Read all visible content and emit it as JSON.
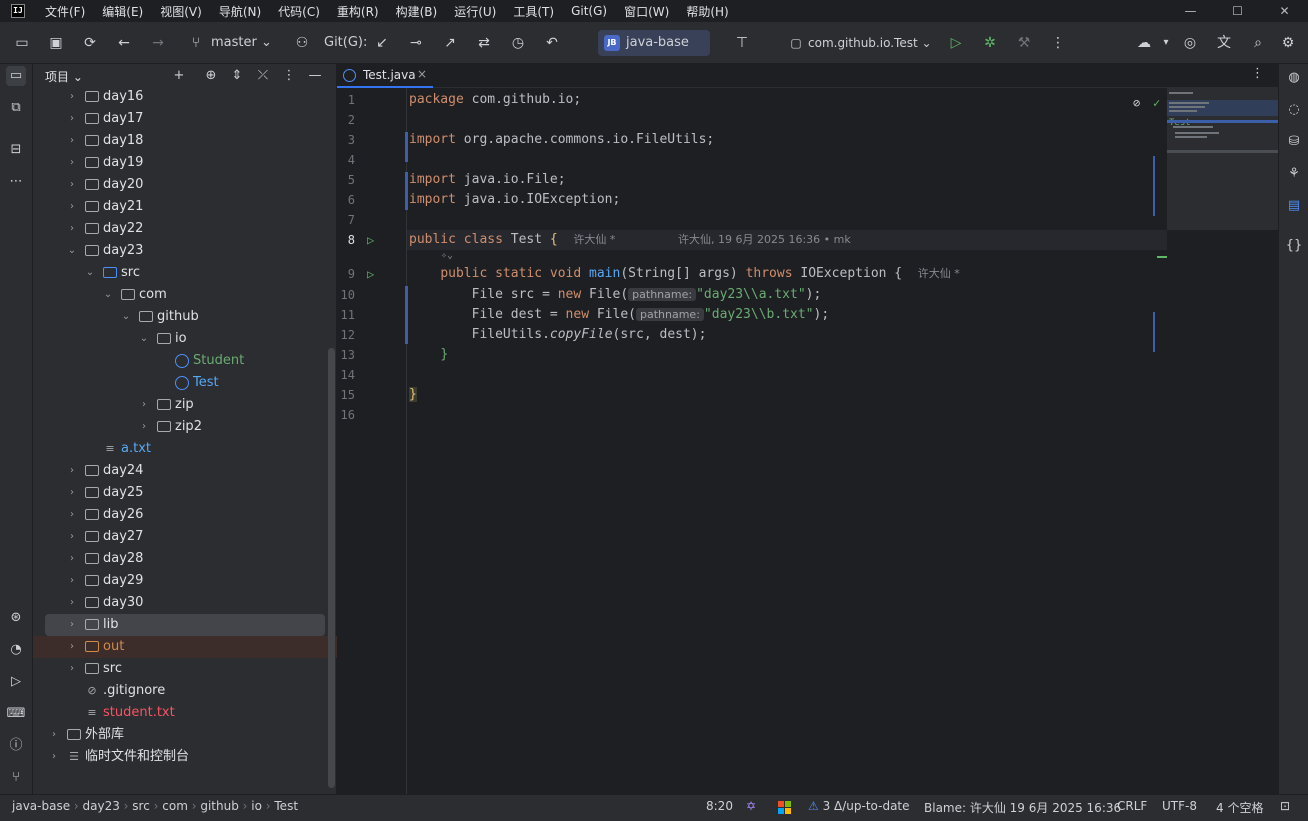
{
  "menu": [
    "文件(F)",
    "编辑(E)",
    "视图(V)",
    "导航(N)",
    "代码(C)",
    "重构(R)",
    "构建(B)",
    "运行(U)",
    "工具(T)",
    "Git(G)",
    "窗口(W)",
    "帮助(H)"
  ],
  "toolbar": {
    "branch": "master",
    "git_label": "Git(G):",
    "project_badge": "JB",
    "project_name": "java-base",
    "run_config": "com.github.io.Test"
  },
  "panel": {
    "title": "项目"
  },
  "tree": [
    {
      "label": "day16",
      "arrow": "›"
    },
    {
      "label": "day17",
      "arrow": "›"
    },
    {
      "label": "day18",
      "arrow": "›"
    },
    {
      "label": "day19",
      "arrow": "›"
    },
    {
      "label": "day20",
      "arrow": "›"
    },
    {
      "label": "day21",
      "arrow": "›"
    },
    {
      "label": "day22",
      "arrow": "›"
    },
    {
      "label": "day23",
      "arrow": "⌄"
    },
    {
      "label": "src",
      "arrow": "⌄"
    },
    {
      "label": "com",
      "arrow": "⌄"
    },
    {
      "label": "github",
      "arrow": "⌄"
    },
    {
      "label": "io",
      "arrow": "⌄"
    },
    {
      "label": "Student",
      "icon": "C"
    },
    {
      "label": "Test",
      "icon": "C"
    },
    {
      "label": "zip",
      "arrow": "›"
    },
    {
      "label": "zip2",
      "arrow": "›"
    },
    {
      "label": "a.txt"
    },
    {
      "label": "day24",
      "arrow": "›"
    },
    {
      "label": "day25",
      "arrow": "›"
    },
    {
      "label": "day26",
      "arrow": "›"
    },
    {
      "label": "day27",
      "arrow": "›"
    },
    {
      "label": "day28",
      "arrow": "›"
    },
    {
      "label": "day29",
      "arrow": "›"
    },
    {
      "label": "day30",
      "arrow": "›"
    },
    {
      "label": "lib",
      "arrow": "›"
    },
    {
      "label": "out",
      "arrow": "›"
    },
    {
      "label": "src",
      "arrow": "›"
    },
    {
      "label": ".gitignore"
    },
    {
      "label": "student.txt"
    },
    {
      "label": "外部库",
      "arrow": "›"
    },
    {
      "label": "临时文件和控制台",
      "arrow": "›"
    }
  ],
  "tab": {
    "label": "Test.java",
    "close": "×"
  },
  "code": {
    "line_numbers": [
      "1",
      "2",
      "3",
      "4",
      "5",
      "6",
      "7",
      "8",
      "9",
      "10",
      "11",
      "12",
      "13",
      "14",
      "15",
      "16"
    ],
    "l1_kw": "package",
    "l1_rest": " com.github.io;",
    "l3_kw": "import",
    "l3_rest": " org.apache.commons.io.FileUtils;",
    "l5_kw": "import",
    "l5_rest": " java.io.File;",
    "l6_kw": "import",
    "l6_rest": " java.io.IOException;",
    "l8_kw": "public class",
    "l8_name": " Test ",
    "l8_brace": "{",
    "l8_author": "许大仙 *",
    "l8_blame": "许大仙, 19 6月 2025 16:36 • mk",
    "l9_kw1": "public static void",
    "l9_fn": "main",
    "l9_args": "(String[] args) ",
    "l9_kw2": "throws",
    "l9_exc": " IOException {",
    "l9_author": "许大仙 *",
    "l10_a": "File src = ",
    "l10_kw": "new",
    "l10_b": " File(",
    "l10_hint": "pathname:",
    "l10_str": "\"day23\\\\a.txt\"",
    "l10_c": ");",
    "l11_a": "File dest = ",
    "l11_kw": "new",
    "l11_b": " File(",
    "l11_hint": "pathname:",
    "l11_str": "\"day23\\\\b.txt\"",
    "l11_c": ");",
    "l12_a": "FileUtils.",
    "l12_fn": "copyFile",
    "l12_b": "(src, dest);",
    "l13": "}",
    "l15": "}"
  },
  "minimap": {
    "label": "Test"
  },
  "status": {
    "crumbs": [
      "java-base",
      "day23",
      "src",
      "com",
      "github",
      "io",
      "Test"
    ],
    "position": "8:20",
    "vcs": "3 Δ/up-to-date",
    "blame": "Blame: 许大仙 19 6月 2025 16:36",
    "line_sep": "CRLF",
    "encoding": "UTF-8",
    "indent": "4 个空格"
  },
  "colors": {
    "accent": "#3574f0",
    "keyword": "#cf8e6d",
    "string": "#6aab73",
    "function": "#56a8f5"
  }
}
